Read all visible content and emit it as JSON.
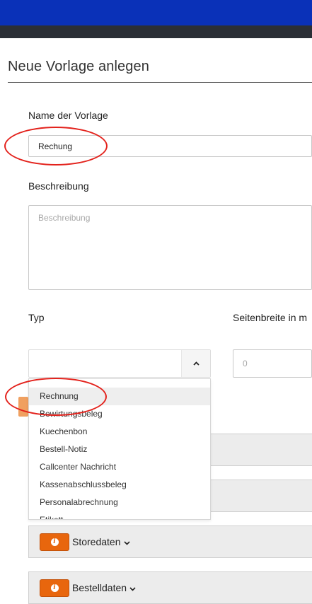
{
  "page_title": "Neue Vorlage anlegen",
  "form": {
    "name_label": "Name der Vorlage",
    "name_value": "Rechung",
    "description_label": "Beschreibung",
    "description_placeholder": "Beschreibung",
    "type_label": "Typ",
    "page_width_label": "Seitenbreite in m",
    "page_width_value": "0"
  },
  "type_dropdown": {
    "options": [
      "Rechnung",
      "Bewirtungsbeleg",
      "Kuechenbon",
      "Bestell-Notiz",
      "Callcenter Nachricht",
      "Kassenabschlussbeleg",
      "Personalabrechnung",
      "Etikett"
    ],
    "highlighted": "Rechnung"
  },
  "panels": [
    {
      "label": "Storedaten",
      "icon": "info-icon"
    },
    {
      "label": "Bestelldaten",
      "icon": "info-icon"
    }
  ],
  "icons": {
    "select_arrow": "chevron-up-icon",
    "panel_chevron": "chevron-down-icon"
  },
  "colors": {
    "topbar": "#0a31b8",
    "info_button": "#e8660d",
    "annotation": "#e3221c"
  }
}
